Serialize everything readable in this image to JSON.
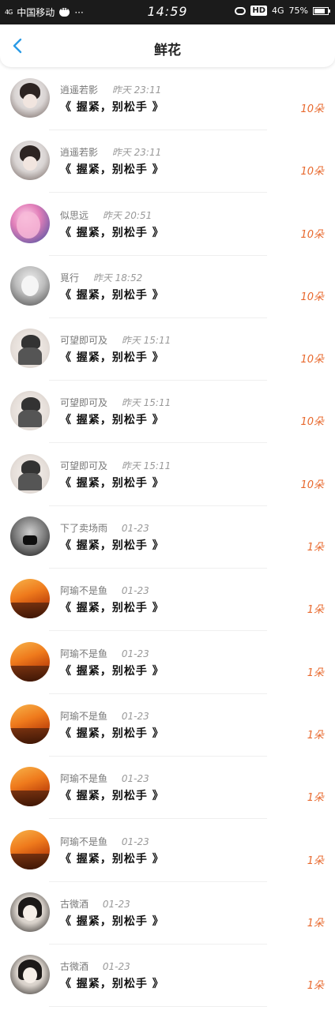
{
  "status_bar": {
    "signal": "4G",
    "carrier": "中国移动",
    "dots": "···",
    "time": "14:59",
    "hd": "HD",
    "network": "4G",
    "battery": "75%"
  },
  "header": {
    "title": "鲜花"
  },
  "list": [
    {
      "name": "逍遥若影",
      "time": "昨天 23:11",
      "message": "《 握紧，别松手 》",
      "count": "10朵",
      "avatar": "anime"
    },
    {
      "name": "逍遥若影",
      "time": "昨天 23:11",
      "message": "《 握紧，别松手 》",
      "count": "10朵",
      "avatar": "anime"
    },
    {
      "name": "似思远",
      "time": "昨天 20:51",
      "message": "《 握紧，别松手 》",
      "count": "10朵",
      "avatar": "pink"
    },
    {
      "name": "覓行",
      "time": "昨天 18:52",
      "message": "《 握紧，别松手 》",
      "count": "10朵",
      "avatar": "gray"
    },
    {
      "name": "可望即可及",
      "time": "昨天 15:11",
      "message": "《 握紧，别松手 》",
      "count": "10朵",
      "avatar": "helmet"
    },
    {
      "name": "可望即可及",
      "time": "昨天 15:11",
      "message": "《 握紧，别松手 》",
      "count": "10朵",
      "avatar": "helmet"
    },
    {
      "name": "可望即可及",
      "time": "昨天 15:11",
      "message": "《 握紧，别松手 》",
      "count": "10朵",
      "avatar": "helmet"
    },
    {
      "name": "下了卖场雨",
      "time": "01-23",
      "message": "《 握紧，别松手 》",
      "count": "1朵",
      "avatar": "mask"
    },
    {
      "name": "阿瑜不是鱼",
      "time": "01-23",
      "message": "《 握紧，别松手 》",
      "count": "1朵",
      "avatar": "sunset"
    },
    {
      "name": "阿瑜不是鱼",
      "time": "01-23",
      "message": "《 握紧，别松手 》",
      "count": "1朵",
      "avatar": "sunset"
    },
    {
      "name": "阿瑜不是鱼",
      "time": "01-23",
      "message": "《 握紧，别松手 》",
      "count": "1朵",
      "avatar": "sunset"
    },
    {
      "name": "阿瑜不是鱼",
      "time": "01-23",
      "message": "《 握紧，别松手 》",
      "count": "1朵",
      "avatar": "sunset"
    },
    {
      "name": "阿瑜不是鱼",
      "time": "01-23",
      "message": "《 握紧，别松手 》",
      "count": "1朵",
      "avatar": "sunset"
    },
    {
      "name": "古微酒",
      "time": "01-23",
      "message": "《 握紧，别松手 》",
      "count": "1朵",
      "avatar": "girl"
    },
    {
      "name": "古微酒",
      "time": "01-23",
      "message": "《 握紧，别松手 》",
      "count": "1朵",
      "avatar": "girl"
    }
  ],
  "colors": {
    "accent": "#2a9be6",
    "count": "#e8692e",
    "status_bar": "#1b1b1b"
  }
}
